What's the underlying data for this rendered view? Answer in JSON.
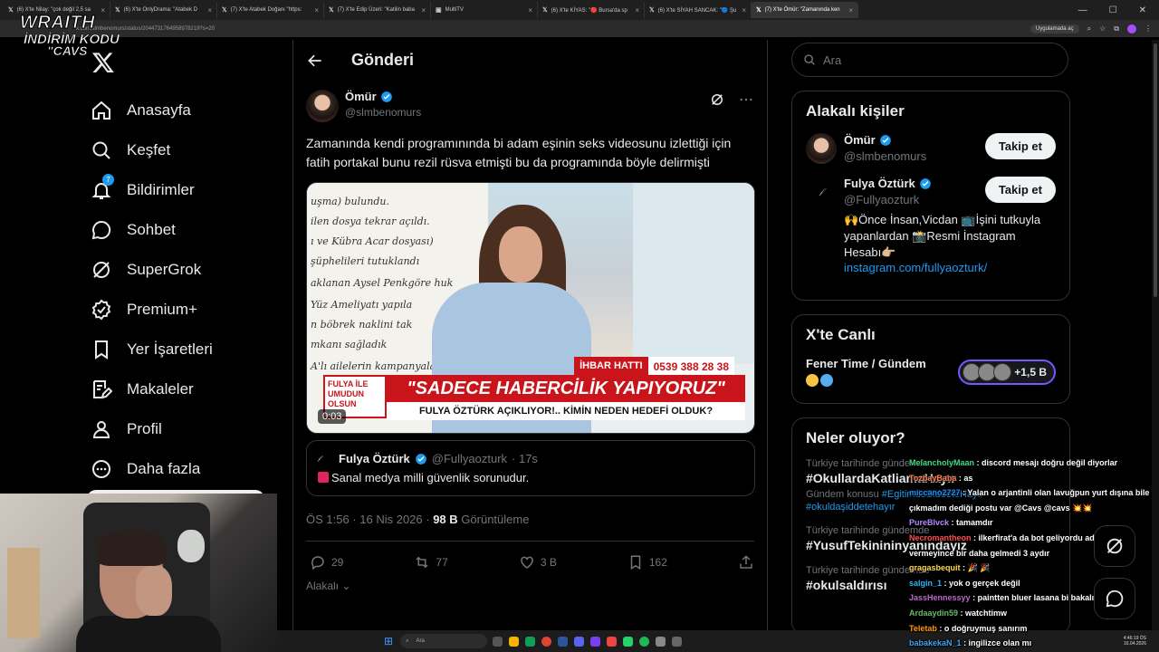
{
  "browser": {
    "tabs": [
      {
        "title": "(6) X'te Nilay: \"çok değil 2,5 sa"
      },
      {
        "title": "(6) X'te OnlyDrama: \"Atabek D"
      },
      {
        "title": "(7) X'te Atabek Doğanı \"https:"
      },
      {
        "title": "(7) X'te Edip Üzeri: \"Katilin baba"
      },
      {
        "title": "MultiTV"
      },
      {
        "title": "(6) X'te KİYAS: \"🔴 Bursa'da sp"
      },
      {
        "title": "(6) X'te SİYAH SANCAK: \"🔵 Şu"
      },
      {
        "title": "(7) X'te Ömür: \"Zamanında ken"
      }
    ],
    "url": "x.com/slmbenomurs/status/2044731764958978219?s=20",
    "open_in_app": "Uygulamada aç"
  },
  "overlay": {
    "line1": "WRAITH",
    "line2": "İNDİRİM KODU",
    "line3": "\"CAVS"
  },
  "nav": {
    "items": [
      {
        "label": "Anasayfa",
        "icon": "home-icon"
      },
      {
        "label": "Keşfet",
        "icon": "search-icon"
      },
      {
        "label": "Bildirimler",
        "icon": "bell-icon",
        "badge": "7"
      },
      {
        "label": "Sohbet",
        "icon": "chat-icon"
      },
      {
        "label": "SuperGrok",
        "icon": "grok-icon"
      },
      {
        "label": "Premium+",
        "icon": "premium-icon"
      },
      {
        "label": "Yer İşaretleri",
        "icon": "bookmark-icon"
      },
      {
        "label": "Makaleler",
        "icon": "articles-icon"
      },
      {
        "label": "Profil",
        "icon": "profile-icon"
      },
      {
        "label": "Daha fazla",
        "icon": "more-icon"
      }
    ]
  },
  "post": {
    "header": "Gönderi",
    "author_name": "Ömür",
    "author_handle": "@slmbenomurs",
    "text": "Zamanında kendi programınında bi adam eşinin seks  videosunu izlettiği için fatih portakal bunu rezil rüsva etmişti bu da programında böyle delirmişti",
    "media": {
      "board_lines": [
        "uşma) bulundu.",
        "ilen dosya tekrar açıldı.",
        "ı ve Kübra Acar dosyası)",
        "şüphelileri tutuklandı",
        "aklanan Aysel Penkgöre huk",
        "Yüz Ameliyatı yapıla",
        "n böbrek naklini tak",
        "mkanı sağladık",
        "A'lı ailelerin kampanyala"
      ],
      "hotline_label": "İHBAR HATTI",
      "hotline_number": "0539 388 28 38",
      "show_logo": "FULYA İLE UMUDUN OLSUN",
      "banner": "\"SADECE HABERCİLİK YAPIYORUZ\"",
      "subbanner": "FULYA ÖZTÜRK AÇIKLIYOR!.. KİMİN NEDEN HEDEFİ OLDUK?",
      "timecode": "0:03"
    },
    "quote": {
      "name": "Fulya Öztürk",
      "handle": "@Fullyaozturk",
      "time": "· 17s",
      "text": "Sanal medya milli güvenlik sorunudur."
    },
    "time": "ÖS 1:56 · 16 Nis 2026 ·",
    "views": "98 B",
    "views_label": "Görüntüleme",
    "replies": "29",
    "reposts": "77",
    "likes": "3 B",
    "bookmarks": "162",
    "relevant": "Alakalı"
  },
  "sidebar": {
    "search_placeholder": "Ara",
    "related_title": "Alakalı kişiler",
    "people": [
      {
        "name": "Ömür",
        "handle": "@slmbenomurs",
        "follow": "Takip et"
      },
      {
        "name": "Fulya Öztürk",
        "handle": "@Fullyaozturk",
        "follow": "Takip et",
        "bio": "🙌Önce İnsan,Vicdan 📺İşini tutkuyla yapanlardan 📸Resmi İnstagram Hesabı👉🏼",
        "link": "instagram.com/fullyaozturk/"
      }
    ],
    "live_title": "X'te Canlı",
    "live_name": "Fener Time / Gündem",
    "live_count": "+1,5 B",
    "trends_title": "Neler oluyor?",
    "trends": [
      {
        "context": "Türkiye tarihinde gündemde",
        "name": "#OkullardaKatliamaHayır",
        "sub": ""
      },
      {
        "context": "Gündem konusu",
        "name": "#EgitimdeSiddeteHayır",
        "sub": "#okuldaşiddetehayır"
      },
      {
        "context": "Türkiye tarihinde gündemde",
        "name": "#YusufTekinininyanındayız",
        "sub": ""
      },
      {
        "context": "Türkiye tarihinde gündemde",
        "name": "#okulsaldırısı",
        "sub": ""
      }
    ]
  },
  "chat": [
    {
      "user": "MelancholyMaan",
      "color": "#3ddc84",
      "msg": ": discord mesajı doğru değil diyorlar"
    },
    {
      "user": "TozbayBaba",
      "color": "#ff7f50",
      "msg": ": as"
    },
    {
      "user": "miccano2727",
      "color": "#1e90ff",
      "msg": ": Yalan o arjantinli olan lavuğpun yurt dışına bile çıkmadım dediği postu var @Cavs @cavs 💥💥"
    },
    {
      "user": "PureBlvck",
      "color": "#b388ff",
      "msg": ": tamamdır"
    },
    {
      "user": "Necromantheon",
      "color": "#ff4d4d",
      "msg": ": ilkerfirat'a da bot geliyordu adam pisim vermeyince bir daha gelmedi 3 aydır"
    },
    {
      "user": "gragasbequit",
      "color": "#ffd54f",
      "msg": ": 🎉 🎉"
    },
    {
      "user": "salgin_1",
      "color": "#29b6f6",
      "msg": ": yok o gerçek değil"
    },
    {
      "user": "JassHennessyy",
      "color": "#ba68c8",
      "msg": ": paintten bluer lasana bi bakalım"
    },
    {
      "user": "Ardaaydin59",
      "color": "#66bb6a",
      "msg": ": watchtimw"
    },
    {
      "user": "Teletab",
      "color": "#ff9800",
      "msg": ": o doğruymuş sanırım"
    },
    {
      "user": "babakekaN_1",
      "color": "#42a5f5",
      "msg": ": ingilizce olan mı"
    }
  ],
  "taskbar": {
    "search": "Ara",
    "time": "4:46:19 ÖS",
    "date": "16.04.2026"
  }
}
